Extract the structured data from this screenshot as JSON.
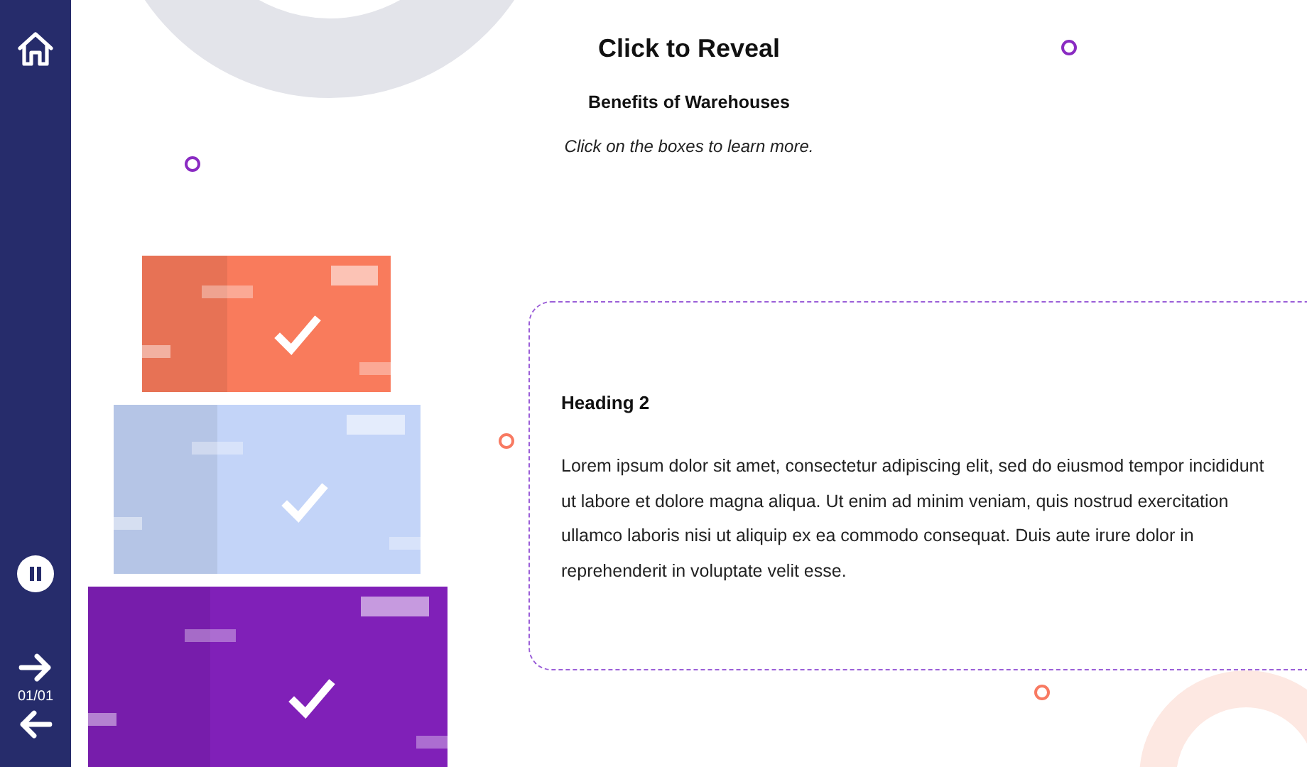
{
  "sidebar": {
    "page_counter": "01/01"
  },
  "header": {
    "title": "Click to Reveal",
    "subtitle": "Benefits of Warehouses",
    "instruction": "Click on the boxes to learn more."
  },
  "boxes": [
    {
      "color": "#f97b5c",
      "visited": true
    },
    {
      "color": "#c3d4f8",
      "visited": true
    },
    {
      "color": "#8020b8",
      "visited": true
    }
  ],
  "card": {
    "heading": "Heading 2",
    "body": "Lorem ipsum dolor sit amet, consectetur adipiscing elit, sed do eiusmod tempor incididunt ut labore et dolore magna aliqua. Ut enim ad minim veniam, quis nostrud exercitation ullamco laboris nisi ut aliquip ex ea commodo consequat. Duis aute irure dolor in reprehenderit in voluptate velit esse."
  }
}
